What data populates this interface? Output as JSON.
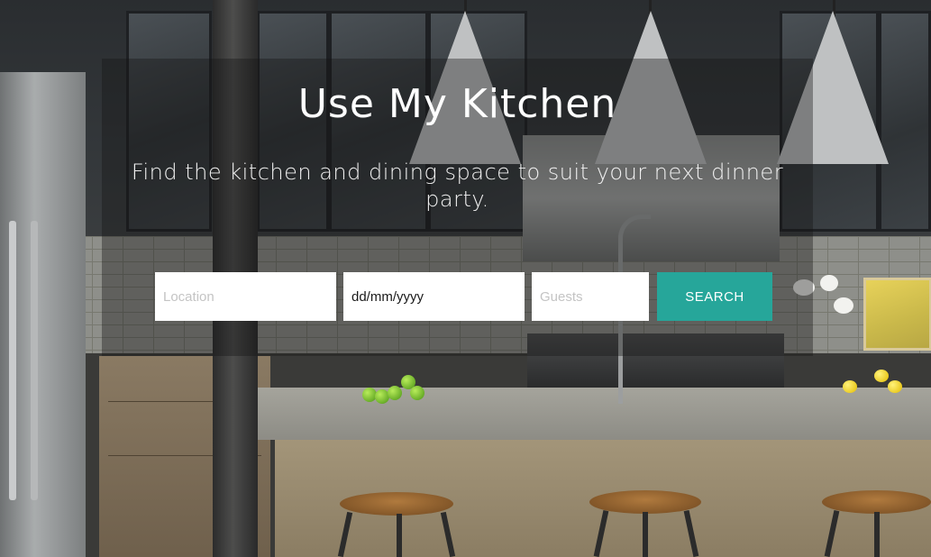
{
  "hero": {
    "title": "Use My Kitchen",
    "subtitle": "Find the kitchen and dining space to suit your next dinner party."
  },
  "search_form": {
    "location": {
      "placeholder": "Location",
      "value": ""
    },
    "date": {
      "placeholder": "dd/mm/yyyy",
      "value": "dd/mm/yyyy"
    },
    "guests": {
      "placeholder": "Guests",
      "value": ""
    },
    "submit_label": "SEARCH"
  },
  "colors": {
    "accent": "#26a69a",
    "overlay": "rgba(20,20,22,0.38)",
    "text_on_dark": "#ffffff"
  }
}
